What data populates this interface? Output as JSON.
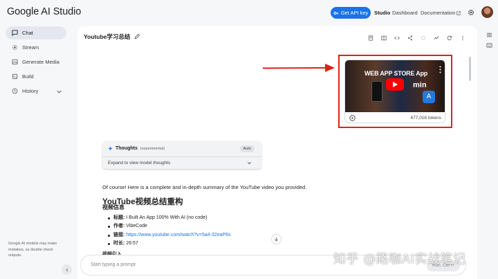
{
  "app": {
    "title": "Google AI Studio"
  },
  "header": {
    "api_key_label": "Get API key",
    "nav": [
      "Studio",
      "Dashboard",
      "Documentation"
    ]
  },
  "sidebar": {
    "items": [
      {
        "label": "Chat",
        "icon": "chat-icon",
        "active": true
      },
      {
        "label": "Stream",
        "icon": "stream-icon"
      },
      {
        "label": "Generate Media",
        "icon": "media-icon"
      },
      {
        "label": "Build",
        "icon": "build-icon"
      },
      {
        "label": "History",
        "icon": "history-icon"
      }
    ],
    "disclaimer": "Google AI models may make mistakes, so double-check outputs."
  },
  "chat": {
    "title": "Youtube学习总结",
    "video": {
      "thumbnail_text": "WEB APP STORE App",
      "thumbnail_text2": "min",
      "tokens": "477,016 tokens"
    },
    "thoughts": {
      "title": "Thoughts",
      "tag": "(experimental)",
      "badge": "Auto",
      "expand_label": "Expand to view model thoughts"
    },
    "response": {
      "intro": "Of course! Here is a complete and in-depth summary of the YouTube video you provided.",
      "heading": "YouTube视频总结重构",
      "subheading": "视频信息",
      "items": [
        {
          "key": "标题:",
          "value": "I Built An App 100% With AI (no code)"
        },
        {
          "key": "作者:",
          "value": "VibeCode"
        },
        {
          "key": "链接:",
          "value": "https://www.youtube.com/watch?v=5a4-32eaP6s"
        },
        {
          "key": "时长:",
          "value": "26:57"
        }
      ],
      "next_heading": "视频引入"
    },
    "prompt_placeholder": "Start typing a prompt",
    "run_label": "Run",
    "run_shortcut": "Ctrl ↵"
  },
  "watermark": "知乎 @路咖AI实战笔记",
  "colors": {
    "accent": "#1a73e8",
    "annotation": "#e0201b"
  }
}
